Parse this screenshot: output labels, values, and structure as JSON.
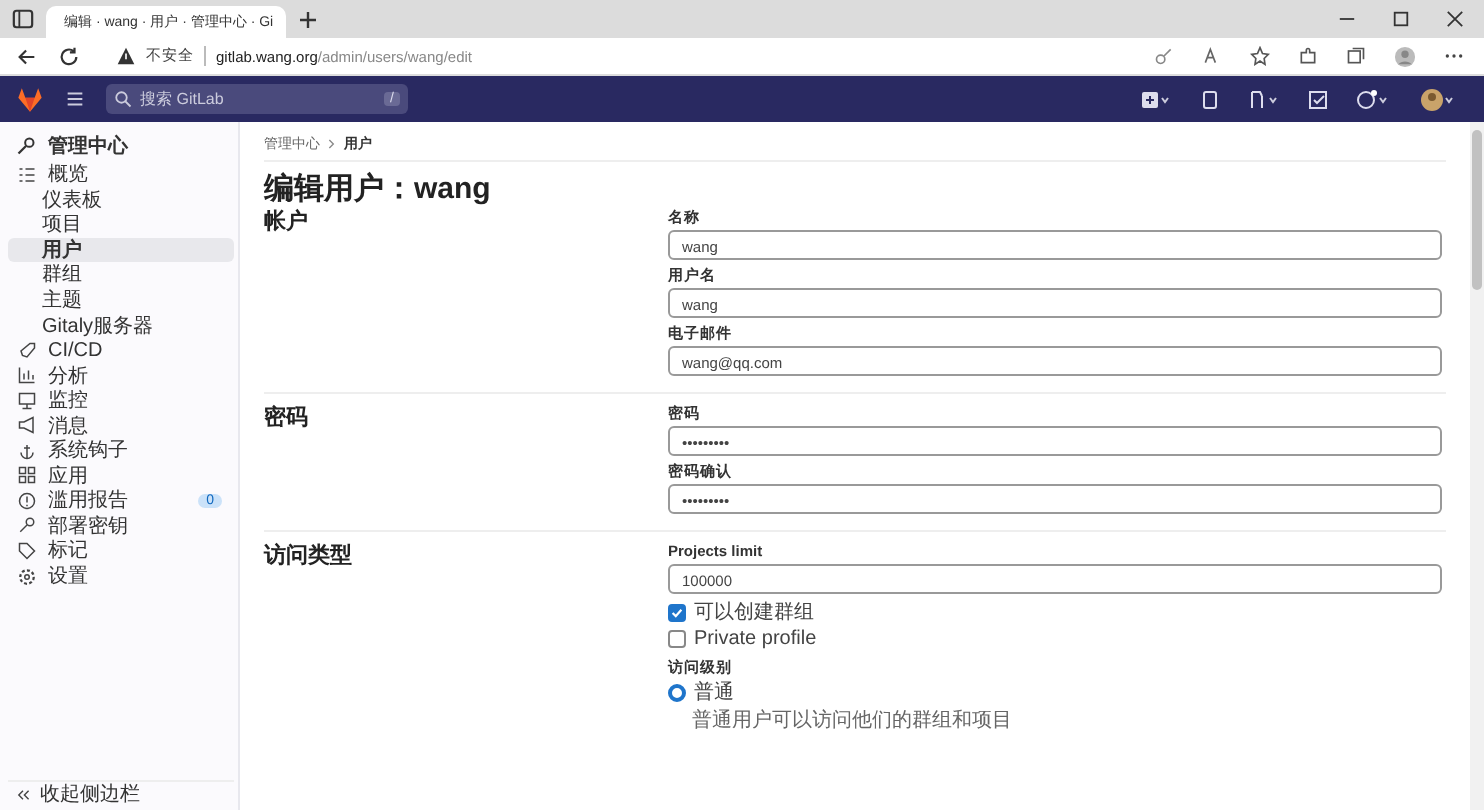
{
  "browser": {
    "tab_title": "编辑 · wang · 用户 · 管理中心 · Gi",
    "security": "不安全",
    "url_host": "gitlab.wang.org",
    "url_path": "/admin/users/wang/edit"
  },
  "topnav": {
    "search_placeholder": "搜索 GitLab",
    "search_key": "/"
  },
  "sidebar": {
    "header": "管理中心",
    "items": [
      {
        "label": "概览",
        "selected": false,
        "children": [
          {
            "label": "仪表板",
            "selected": false
          },
          {
            "label": "项目",
            "selected": false
          },
          {
            "label": "用户",
            "selected": true
          },
          {
            "label": "群组",
            "selected": false
          },
          {
            "label": "主题",
            "selected": false
          },
          {
            "label": "Gitaly服务器",
            "selected": false
          }
        ]
      },
      {
        "label": "CI/CD",
        "selected": false
      },
      {
        "label": "分析",
        "selected": false
      },
      {
        "label": "监控",
        "selected": false
      },
      {
        "label": "消息",
        "selected": false
      },
      {
        "label": "系统钩子",
        "selected": false
      },
      {
        "label": "应用",
        "selected": false
      },
      {
        "label": "滥用报告",
        "selected": false,
        "badge": "0"
      },
      {
        "label": "部署密钥",
        "selected": false
      },
      {
        "label": "标记",
        "selected": false
      },
      {
        "label": "设置",
        "selected": false
      }
    ],
    "collapse": "收起侧边栏"
  },
  "breadcrumb": [
    "管理中心",
    "用户"
  ],
  "title": "编辑用户：wang",
  "sections": [
    {
      "title": "帐户",
      "fields": [
        {
          "kind": "text",
          "label": "名称",
          "value": "wang"
        },
        {
          "kind": "text",
          "label": "用户名",
          "value": "wang"
        },
        {
          "kind": "text",
          "label": "电子邮件",
          "value": "wang@qq.com"
        }
      ]
    },
    {
      "title": "密码",
      "fields": [
        {
          "kind": "text",
          "label": "密码",
          "value": "•••••••••"
        },
        {
          "kind": "text",
          "label": "密码确认",
          "value": "•••••••••"
        }
      ]
    },
    {
      "title": "访问类型",
      "fields": [
        {
          "kind": "text",
          "label": "Projects limit",
          "value": "100000"
        },
        {
          "kind": "checkbox",
          "label": "可以创建群组",
          "checked": true
        },
        {
          "kind": "checkbox",
          "label": "Private profile",
          "checked": false
        },
        {
          "kind": "radio-group",
          "label": "访问级别",
          "options": [
            {
              "label": "普通",
              "selected": true,
              "description": "普通用户可以访问他们的群组和项目"
            }
          ]
        }
      ]
    }
  ]
}
